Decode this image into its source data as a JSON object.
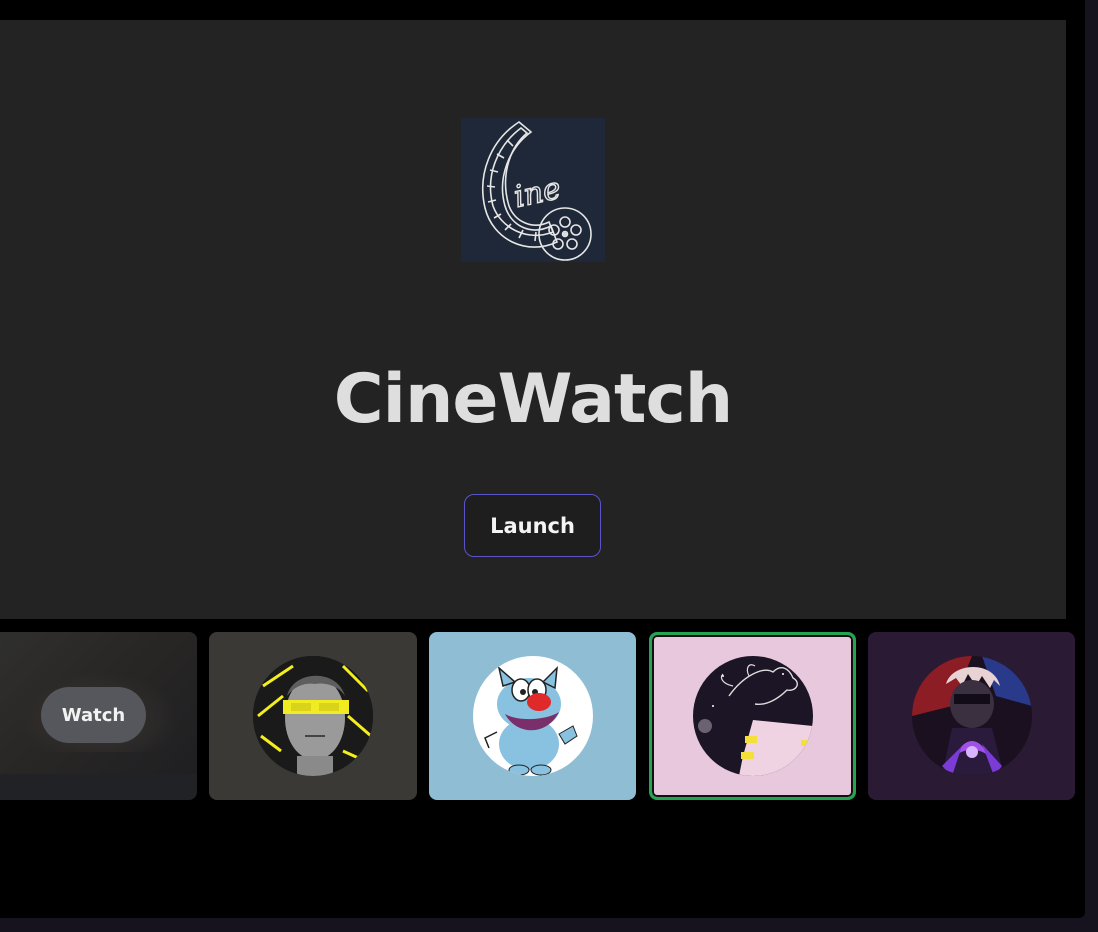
{
  "app": {
    "title": "CineWatch",
    "launch_label": "Launch",
    "logo_text": "ine"
  },
  "carousel": {
    "cards": [
      {
        "name": "card-landscape",
        "button_label": "Watch",
        "background": "#212226"
      },
      {
        "name": "card-statue",
        "background": "#3a3935"
      },
      {
        "name": "card-oggy",
        "background": "#8fbdd4"
      },
      {
        "name": "card-hand-sketch",
        "background": "#e7c8dc",
        "selected": true
      },
      {
        "name": "card-anime",
        "background": "#2b1a33"
      }
    ]
  },
  "colors": {
    "hero_bg": "#232323",
    "accent_border": "#5a54c8",
    "selected_border": "#23a552"
  },
  "icons": [
    "cinewatch-logo-icon"
  ]
}
